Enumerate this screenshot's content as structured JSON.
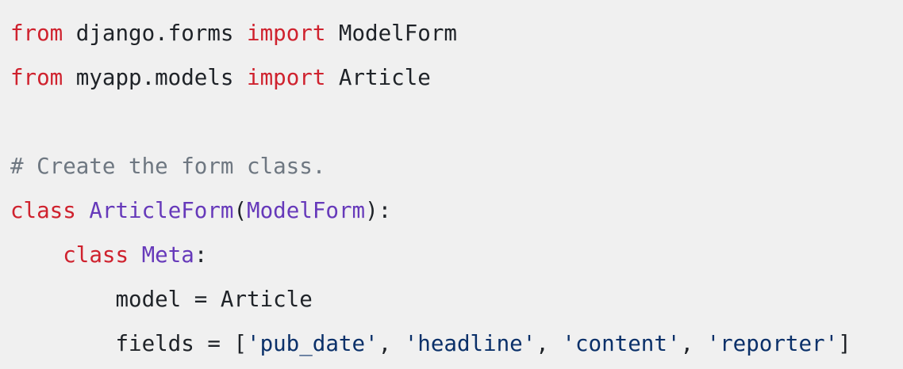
{
  "colors": {
    "background": "#f0f0f0",
    "keyword": "#cf222e",
    "title": "#6639ba",
    "comment": "#6e7781",
    "string": "#0a3069",
    "plain": "#1f2328"
  },
  "code": {
    "line1": {
      "k1": "from",
      "t1": " django.forms ",
      "k2": "import",
      "t2": " ModelForm"
    },
    "line2": {
      "k1": "from",
      "t1": " myapp.models ",
      "k2": "import",
      "t2": " Article"
    },
    "line4": {
      "comment": "# Create the form class."
    },
    "line5": {
      "k1": "class",
      "s1": " ",
      "n1": "ArticleForm",
      "p1": "(",
      "n2": "ModelForm",
      "p2": "):"
    },
    "line6": {
      "indent": "    ",
      "k1": "class",
      "s1": " ",
      "n1": "Meta",
      "p1": ":"
    },
    "line7": {
      "text": "        model = Article"
    },
    "line8": {
      "t1": "        fields = [",
      "s1": "'pub_date'",
      "c1": ", ",
      "s2": "'headline'",
      "c2": ", ",
      "s3": "'content'",
      "c3": ", ",
      "s4": "'reporter'",
      "t2": "]"
    }
  }
}
